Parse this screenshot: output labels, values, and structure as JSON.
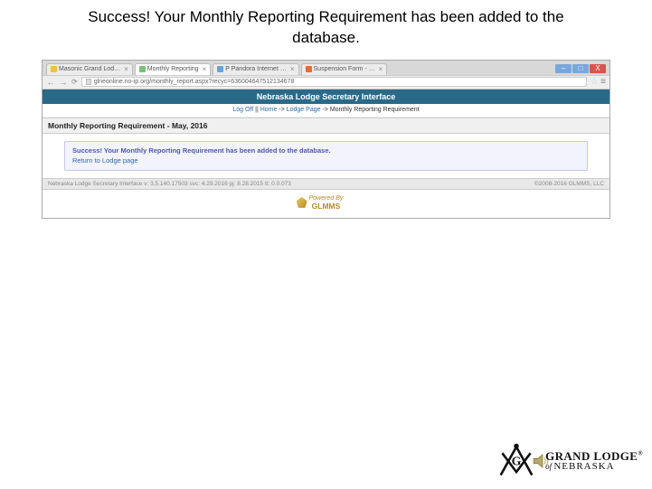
{
  "slide": {
    "title": "Success! Your Monthly Reporting Requirement has been added to the database."
  },
  "browser": {
    "tabs": [
      {
        "label": "Masonic Grand Lod…"
      },
      {
        "label": "Monthly Reporting"
      },
      {
        "label": "P Pandora Internet …"
      },
      {
        "label": "Suspension Form - …"
      }
    ],
    "url": "glneonline.no-ip.org/monthly_report.aspx?recyc=636004647512134678",
    "window_controls": {
      "min": "–",
      "max": "□",
      "close": "X"
    }
  },
  "page": {
    "banner": "Nebraska Lodge Secretary Interface",
    "breadcrumb_logoff": "Log Off",
    "breadcrumb_sep1": " || ",
    "breadcrumb_home": "Home",
    "breadcrumb_arrow1": " -> ",
    "breadcrumb_lodge": "Lodge Page",
    "breadcrumb_arrow2": " -> ",
    "breadcrumb_current": "Monthly Reporting Requirement",
    "section_title": "Monthly Reporting Requirement - May, 2016",
    "success_msg": "Success! Your Monthly Reporting Requirement has been added to the database.",
    "return_link": "Return to Lodge page",
    "footer_left": "Nebraska Lodge Secretary Interface    v: 3.5.140.17503   svc: 4.29.2016   pj: 8.28.2015   tt: 0.0.073",
    "footer_right": "©2008-2016 GLMMS, LLC",
    "powered_pre": "Powered By",
    "powered_name": "GLMMS"
  },
  "logo": {
    "line1": "GRAND LODGE",
    "reg": "®",
    "of": "of ",
    "state": "NEBRASKA"
  }
}
